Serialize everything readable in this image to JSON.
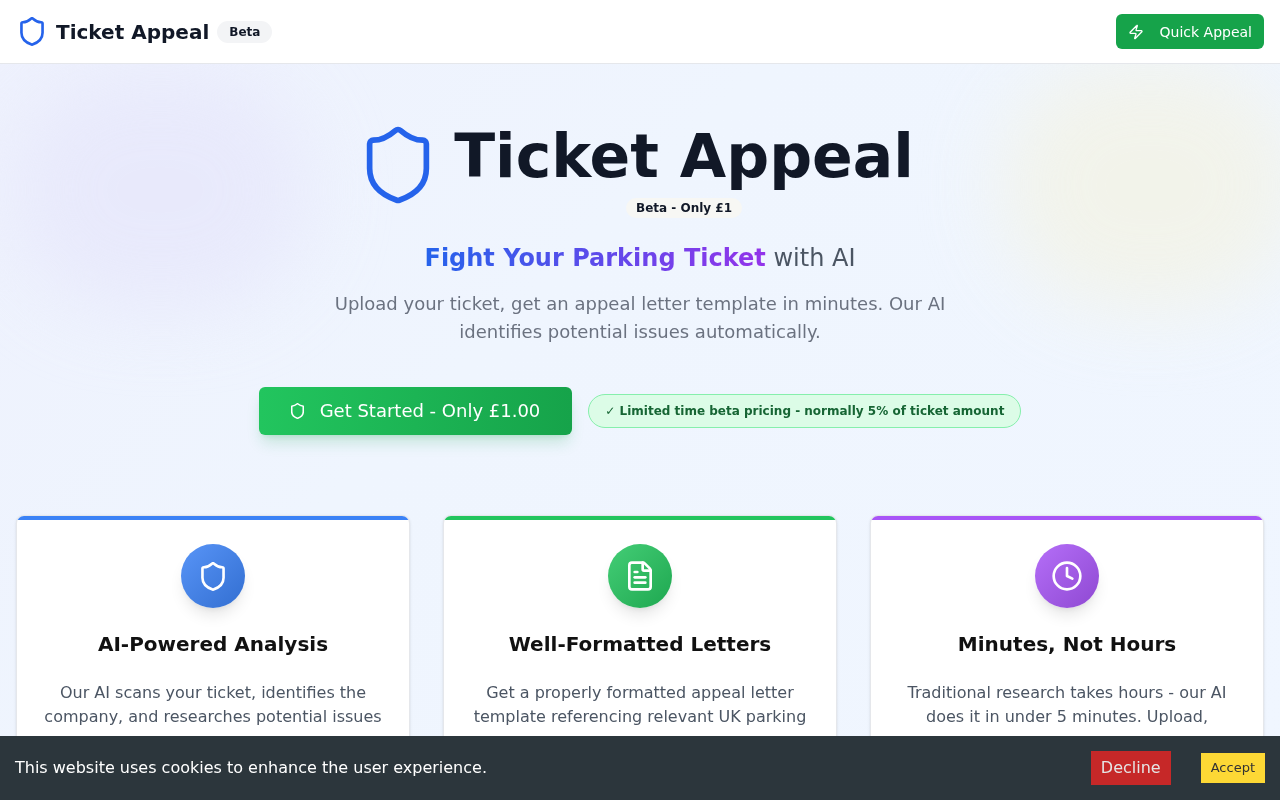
{
  "header": {
    "brand": "Ticket Appeal",
    "badge": "Beta",
    "action": "Quick Appeal"
  },
  "hero": {
    "title": "Ticket Appeal",
    "badge": "Beta - Only £1",
    "tagline": "**Fight Your Parking Ticket** with AI",
    "description": "Upload your ticket, get an appeal letter template in minutes. Our AI identifies potential issues automatically.",
    "cta": "Get Started - Only £1.00",
    "pricing_note": "✓ Limited time beta pricing - normally 5% of ticket amount"
  },
  "features": [
    {
      "title": "AI-Powered Analysis",
      "description": "Our AI scans your ticket, identifies the company, and researches potential issues",
      "color": "#3b82f6"
    },
    {
      "title": "Well-Formatted Letters",
      "description": "Get a properly formatted appeal letter template referencing relevant UK parking",
      "color": "#22c55e"
    },
    {
      "title": "Minutes, Not Hours",
      "description": "Traditional research takes hours - our AI does it in under 5 minutes. Upload,",
      "color": "#a855f7"
    }
  ],
  "cookie_banner": {
    "message": "This website uses cookies to enhance the user experience.",
    "buttons": [
      {
        "label": "Decline",
        "kind": "decline"
      },
      {
        "label": "Accept",
        "kind": "accept"
      }
    ]
  }
}
